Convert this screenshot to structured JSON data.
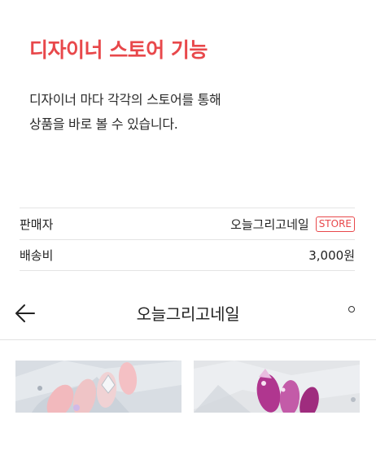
{
  "hero": {
    "title": "디자이너 스토어 기능",
    "description_line1": "디자이너 마다 각각의 스토어를 통해",
    "description_line2": "상품을 바로 볼 수 있습니다."
  },
  "info_table": {
    "seller_label": "판매자",
    "seller_name": "오늘그리고네일",
    "store_badge": "STORE",
    "shipping_label": "배송비",
    "shipping_fee": "3,000원"
  },
  "store_nav": {
    "title": "오늘그리고네일",
    "back_icon": "arrow-left-icon",
    "more_icon": "more-dot-icon"
  },
  "products": [
    {
      "image": "pink-nail-set-image"
    },
    {
      "image": "purple-nail-set-image"
    }
  ],
  "colors": {
    "accent": "#e8484b",
    "text": "#222222",
    "divider": "#e4e4e4"
  }
}
